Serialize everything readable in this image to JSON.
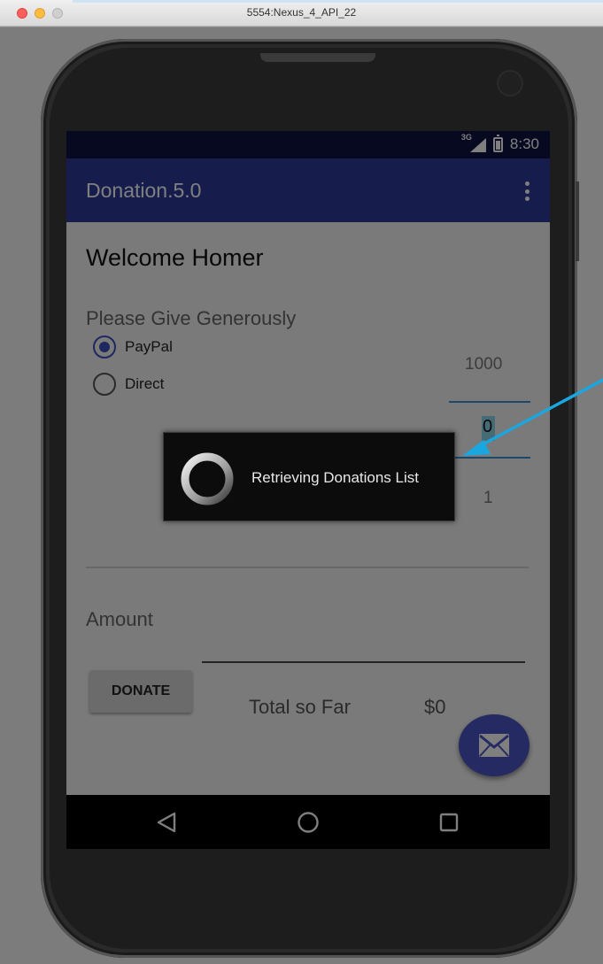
{
  "window": {
    "title": "5554:Nexus_4_API_22"
  },
  "status_bar": {
    "network": "3G",
    "time": "8:30"
  },
  "app_bar": {
    "title": "Donation.5.0"
  },
  "main": {
    "welcome": "Welcome Homer",
    "prompt": "Please Give Generously",
    "payment_methods": [
      {
        "label": "PayPal",
        "selected": true
      },
      {
        "label": "Direct",
        "selected": false
      }
    ],
    "amount_picker": {
      "above": "1000",
      "current": "0",
      "below": "1"
    },
    "amount_label": "Amount",
    "amount_value": "",
    "donate_button": "DONATE",
    "total_label": "Total so Far",
    "total_value": "$0"
  },
  "dialog": {
    "message": "Retrieving Donations List"
  },
  "icons": {
    "fab": "mail-icon",
    "nav": [
      "back-icon",
      "home-icon",
      "recents-icon"
    ],
    "overflow": "overflow-menu-icon"
  },
  "colors": {
    "status_bar": "#0e1240",
    "app_bar": "#2d3a9a",
    "accent": "#3f4fbf",
    "fab": "#4a55c4",
    "annotation_arrow": "#1aa7e0"
  }
}
